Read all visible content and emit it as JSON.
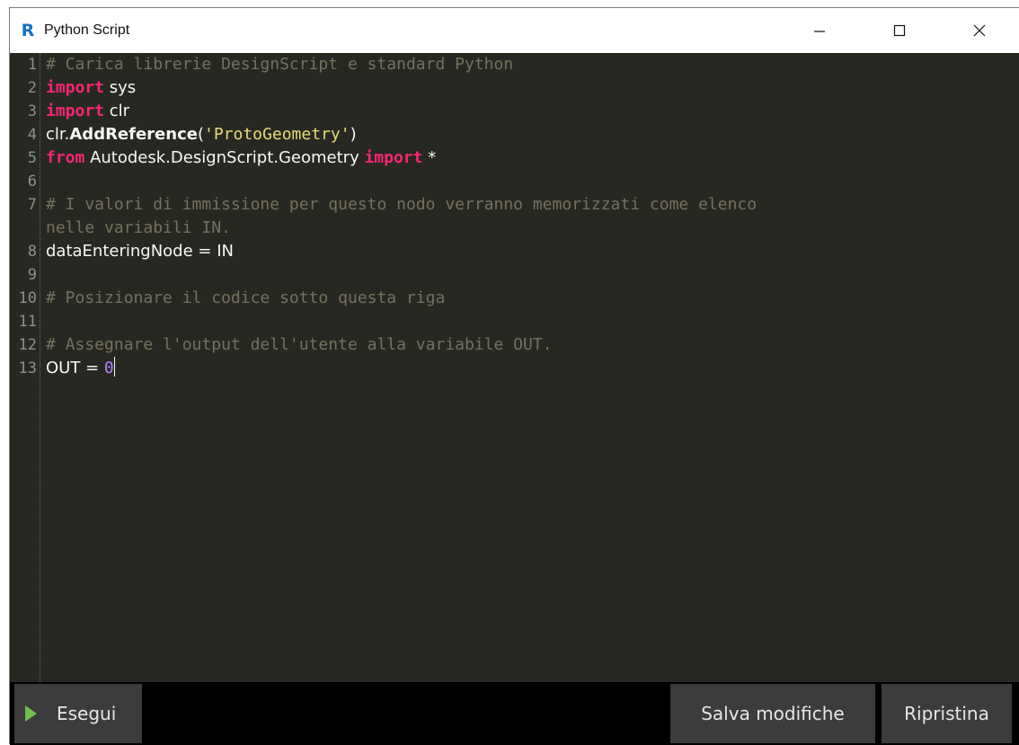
{
  "window": {
    "title": "Python Script",
    "app_icon_letter": "R",
    "controls": [
      "minimize",
      "maximize",
      "close"
    ]
  },
  "editor": {
    "lines": [
      {
        "n": "1",
        "tokens": [
          {
            "t": "comment",
            "v": "# Carica librerie DesignScript e standard Python"
          }
        ]
      },
      {
        "n": "2",
        "tokens": [
          {
            "t": "kw",
            "v": "import"
          },
          {
            "t": "plain",
            "v": " sys"
          }
        ]
      },
      {
        "n": "3",
        "tokens": [
          {
            "t": "kw",
            "v": "import"
          },
          {
            "t": "plain",
            "v": " clr"
          }
        ]
      },
      {
        "n": "4",
        "tokens": [
          {
            "t": "plain",
            "v": "clr."
          },
          {
            "t": "bold",
            "v": "AddReference"
          },
          {
            "t": "plain",
            "v": "("
          },
          {
            "t": "str",
            "v": "'ProtoGeometry'"
          },
          {
            "t": "plain",
            "v": ")"
          }
        ]
      },
      {
        "n": "5",
        "tokens": [
          {
            "t": "kw",
            "v": "from"
          },
          {
            "t": "plain",
            "v": " Autodesk.DesignScript.Geometry "
          },
          {
            "t": "kw",
            "v": "import"
          },
          {
            "t": "plain",
            "v": " *"
          }
        ]
      },
      {
        "n": "6",
        "tokens": []
      },
      {
        "n": "7",
        "tokens": [
          {
            "t": "comment",
            "v": "# I valori di immissione per questo nodo verranno memorizzati come elenco"
          }
        ]
      },
      {
        "n": "",
        "tokens": [
          {
            "t": "comment",
            "v": "nelle variabili IN."
          }
        ]
      },
      {
        "n": "8",
        "tokens": [
          {
            "t": "plain",
            "v": "dataEnteringNode = IN"
          }
        ]
      },
      {
        "n": "9",
        "tokens": []
      },
      {
        "n": "10",
        "tokens": [
          {
            "t": "comment",
            "v": "# Posizionare il codice sotto questa riga"
          }
        ]
      },
      {
        "n": "11",
        "tokens": []
      },
      {
        "n": "12",
        "tokens": [
          {
            "t": "comment",
            "v": "# Assegnare l'output dell'utente alla variabile OUT."
          }
        ]
      },
      {
        "n": "13",
        "tokens": [
          {
            "t": "plain",
            "v": "OUT = "
          },
          {
            "t": "num",
            "v": "0"
          },
          {
            "t": "cursor",
            "v": ""
          }
        ]
      }
    ]
  },
  "toolbar": {
    "run_label": "Esegui",
    "save_label": "Salva modifiche",
    "revert_label": "Ripristina"
  },
  "colors": {
    "editor_bg": "#272822",
    "comment": "#75715e",
    "keyword": "#f92672",
    "string": "#e6db74",
    "number": "#ae81ff",
    "run_icon": "#6fbf4a"
  }
}
